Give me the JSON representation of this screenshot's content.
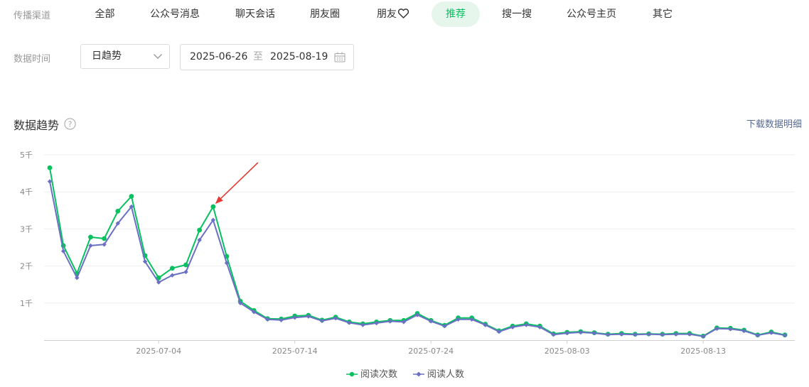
{
  "filters": {
    "channel_label": "传播渠道",
    "tabs": [
      {
        "label": "全部",
        "active": false
      },
      {
        "label": "公众号消息",
        "active": false
      },
      {
        "label": "聊天会话",
        "active": false
      },
      {
        "label": "朋友圈",
        "active": false
      },
      {
        "label": "朋友",
        "active": false,
        "icon": "heart-icon"
      },
      {
        "label": "推荐",
        "active": true
      },
      {
        "label": "搜一搜",
        "active": false
      },
      {
        "label": "公众号主页",
        "active": false
      },
      {
        "label": "其它",
        "active": false
      }
    ],
    "time_label": "数据时间",
    "granularity": "日趋势",
    "date_start": "2025-06-26",
    "date_sep": "至",
    "date_end": "2025-08-19"
  },
  "section": {
    "title": "数据趋势",
    "download_label": "下载数据明细"
  },
  "colors": {
    "accent": "#07c160",
    "series_reads": "#07c160",
    "series_readers": "#6c70c4",
    "link": "#576b95",
    "arrow": "#e53935"
  },
  "chart_data": {
    "type": "line",
    "x_start": "2025-06-26",
    "x_end": "2025-08-19",
    "x_tick_labels": [
      "2025-07-04",
      "2025-07-14",
      "2025-07-24",
      "2025-08-03",
      "2025-08-13"
    ],
    "y_ticks": [
      1000,
      2000,
      3000,
      4000,
      5000
    ],
    "y_tick_labels": [
      "1千",
      "2千",
      "3千",
      "4千",
      "5千"
    ],
    "ylim": [
      0,
      5000
    ],
    "grid": true,
    "legend_position": "bottom-center",
    "annotation": {
      "type": "arrow",
      "target_series": 0,
      "target_date": "2025-07-08"
    },
    "series": [
      {
        "name": "阅读次数",
        "marker": "circle",
        "values": [
          4650,
          2550,
          1800,
          2780,
          2740,
          3480,
          3880,
          2280,
          1680,
          1940,
          2030,
          2970,
          3600,
          2260,
          1050,
          800,
          580,
          570,
          650,
          670,
          540,
          620,
          490,
          440,
          490,
          530,
          530,
          720,
          530,
          400,
          600,
          600,
          430,
          250,
          380,
          440,
          380,
          170,
          210,
          230,
          200,
          160,
          180,
          160,
          170,
          160,
          180,
          180,
          110,
          330,
          320,
          270,
          140,
          220,
          140
        ]
      },
      {
        "name": "阅读人数",
        "marker": "diamond",
        "values": [
          4280,
          2400,
          1680,
          2550,
          2580,
          3150,
          3600,
          2120,
          1560,
          1750,
          1840,
          2700,
          3240,
          2080,
          1000,
          760,
          560,
          540,
          610,
          640,
          520,
          590,
          470,
          410,
          460,
          510,
          490,
          680,
          510,
          380,
          560,
          560,
          410,
          230,
          350,
          410,
          350,
          150,
          190,
          210,
          190,
          150,
          160,
          150,
          160,
          150,
          160,
          160,
          100,
          310,
          300,
          250,
          130,
          200,
          130
        ]
      }
    ]
  }
}
